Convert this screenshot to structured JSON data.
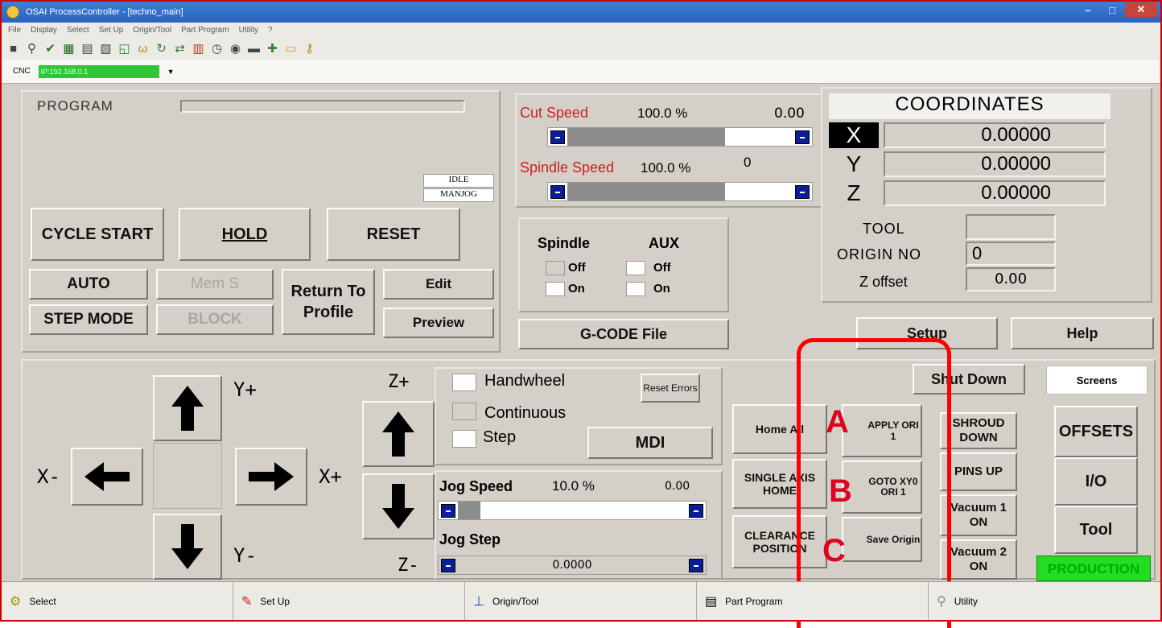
{
  "window": {
    "title": "OSAI ProcessController - [techno_main]",
    "min": "–",
    "max": "□",
    "close": "✕"
  },
  "menu": [
    "File",
    "Display",
    "Select",
    "Set Up",
    "Origin/Tool",
    "Part Program",
    "Utility",
    "?"
  ],
  "cnc": {
    "label": "CNC",
    "ip": "IP:192.168.0.1"
  },
  "program": {
    "label": "PROGRAM",
    "state1": "IDLE",
    "state2": "MANJOG"
  },
  "buttons": {
    "cycle_start": "CYCLE START",
    "hold": "HOLD",
    "reset": "RESET",
    "auto": "AUTO",
    "mem": "Mem S",
    "return_profile": "Return To Profile",
    "edit": "Edit",
    "step_mode": "STEP MODE",
    "block": "BLOCK",
    "preview": "Preview",
    "gcode": "G-CODE File",
    "setup": "Setup",
    "help": "Help",
    "shutdown": "Shut Down",
    "screens": "Screens",
    "offsets": "OFFSETS",
    "io": "I/O",
    "tool": "Tool",
    "production": "PRODUCTION",
    "home_all": "Home All",
    "single_axis_home": "SINGLE AXIS HOME",
    "clearance": "CLEARANCE POSITION",
    "apply": "APPLY ORI 1",
    "goto": "GOTO XY0 ORI 1",
    "save_origin": "Save Origin",
    "shroud": "SHROUD DOWN",
    "pins": "PINS UP",
    "vac1": "Vacuum 1 ON",
    "vac2": "Vacuum 2 ON",
    "mdi": "MDI",
    "reset_errors": "Reset Errors"
  },
  "speeds": {
    "cut_label": "Cut Speed",
    "cut_pct": "100.0 %",
    "cut_val": "0.00",
    "cut_fill": 0.7,
    "spindle_label": "Spindle Speed",
    "spindle_pct": "100.0 %",
    "spindle_val": "0",
    "spindle_fill": 0.7
  },
  "spindle_aux": {
    "spindle": "Spindle",
    "aux": "AUX",
    "off": "Off",
    "on": "On"
  },
  "coords": {
    "title": "COORDINATES",
    "x_label": "X",
    "x": "0.00000",
    "y_label": "Y",
    "y": "0.00000",
    "z_label": "Z",
    "z": "0.00000",
    "tool": "TOOL",
    "origin_no_label": "ORIGIN NO",
    "origin_no": "0",
    "zoff_label": "Z offset",
    "zoff": "0.00"
  },
  "jog": {
    "handwheel": "Handwheel",
    "continuous": "Continuous",
    "step": "Step",
    "speed_label": "Jog Speed",
    "speed_pct": "10.0 %",
    "speed_val": "0.00",
    "speed_fill": 0.1,
    "step_label": "Jog Step",
    "step_val": "0.0000",
    "yplus": "Y+",
    "yminus": "Y-",
    "xplus": "X+",
    "xminus": "X-",
    "zplus": "Z+",
    "zminus": "Z-"
  },
  "callouts": {
    "a": "A",
    "b": "B",
    "c": "C"
  },
  "status": [
    "Select",
    "Set Up",
    "Origin/Tool",
    "Part Program",
    "Utility"
  ],
  "colors": {
    "accent_red": "#ff0000",
    "production_green": "#22dd22",
    "slider_blue": "#0a1f95"
  }
}
